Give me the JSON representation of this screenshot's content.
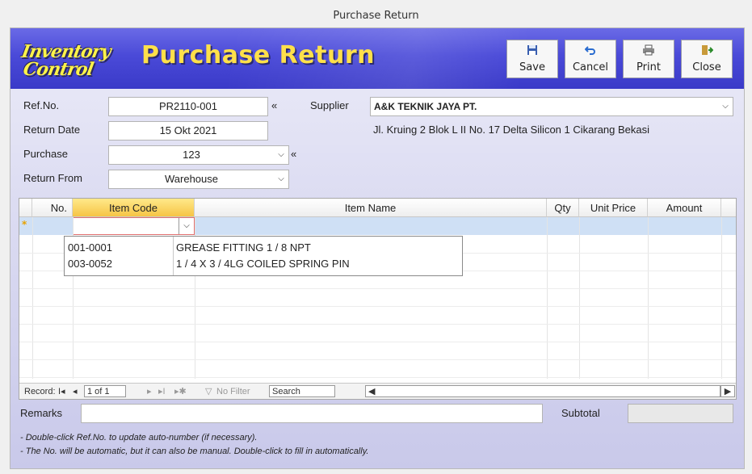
{
  "window": {
    "title": "Purchase Return"
  },
  "header": {
    "logo_line1": "Inventory",
    "logo_line2": "Control",
    "title": "Purchase Return"
  },
  "toolbar": {
    "save_label": "Save",
    "cancel_label": "Cancel",
    "print_label": "Print",
    "close_label": "Close"
  },
  "fields": {
    "refno_label": "Ref.No.",
    "refno_value": "PR2110-001",
    "refno_marker": "«",
    "return_date_label": "Return Date",
    "return_date_value": "15 Okt 2021",
    "purchase_label": "Purchase",
    "purchase_value": "123",
    "purchase_marker": "«",
    "return_from_label": "Return From",
    "return_from_value": "Warehouse",
    "supplier_label": "Supplier",
    "supplier_value": "A&K TEKNIK JAYA PT.",
    "supplier_address": "Jl. Kruing 2 Blok L II No. 17 Delta Silicon 1 Cikarang Bekasi"
  },
  "grid": {
    "columns": [
      "No.",
      "Item Code",
      "Item Name",
      "Qty",
      "Unit Price",
      "Amount"
    ],
    "new_row_marker": "*",
    "dropdown_items": [
      {
        "code": "001-0001",
        "name": "GREASE FITTING 1 / 8 NPT"
      },
      {
        "code": "003-0052",
        "name": "1 / 4 X 3 / 4LG COILED SPRING PIN"
      }
    ],
    "nav": {
      "record_label": "Record:",
      "first": "I◂",
      "prev": "◂",
      "position": "1 of 1",
      "next": "▸",
      "last": "▸I",
      "new": "▸✱",
      "filter": "No Filter",
      "search": "Search"
    }
  },
  "footer": {
    "remarks_label": "Remarks",
    "remarks_value": "",
    "subtotal_label": "Subtotal",
    "subtotal_value": "",
    "note1": "- Double-click Ref.No. to update auto-number (if necessary).",
    "note2": "- The No. will be automatic, but it can also be manual. Double-click to fill in automatically."
  },
  "colors": {
    "header": "#4a4ad8",
    "title_yellow": "#ffe04a",
    "selected_row": "#cfe0f5",
    "active_header": "#f6c445"
  }
}
